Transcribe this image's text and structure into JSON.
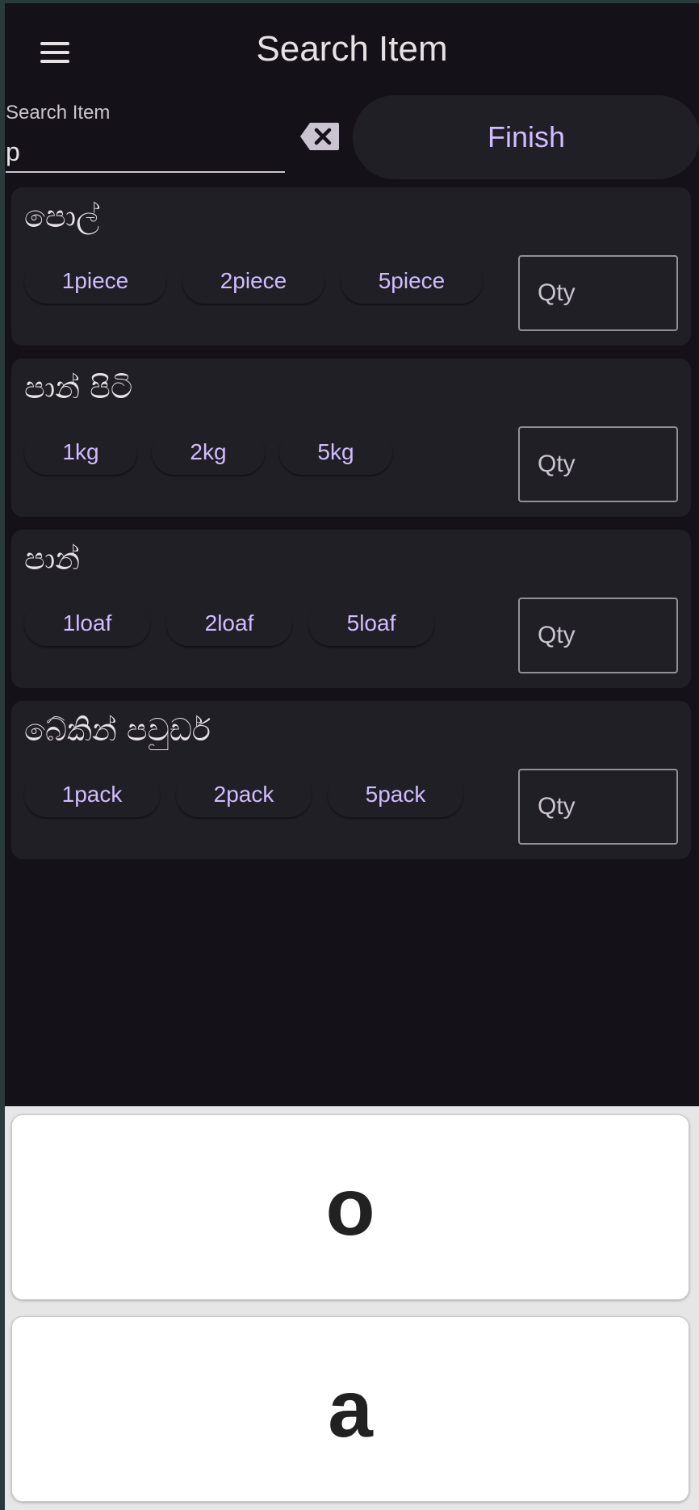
{
  "app": {
    "title": "Search Item"
  },
  "search": {
    "label": "Search Item",
    "value": "p",
    "clear_icon": "backspace-clear-icon"
  },
  "finish_label": "Finish",
  "items": [
    {
      "name": "පොල්",
      "units": [
        "1piece",
        "2piece",
        "5piece"
      ],
      "qty_placeholder": "Qty"
    },
    {
      "name": "පාන් පිටි",
      "units": [
        "1kg",
        "2kg",
        "5kg"
      ],
      "qty_placeholder": "Qty"
    },
    {
      "name": "පාන්",
      "units": [
        "1loaf",
        "2loaf",
        "5loaf"
      ],
      "qty_placeholder": "Qty"
    },
    {
      "name": "බේකින් පවුඩර්",
      "units": [
        "1pack",
        "2pack",
        "5pack"
      ],
      "qty_placeholder": "Qty"
    }
  ],
  "suggestions": [
    "o",
    "a"
  ],
  "colors": {
    "background": "#141218",
    "card": "#211f26",
    "accent": "#d0bcff"
  }
}
